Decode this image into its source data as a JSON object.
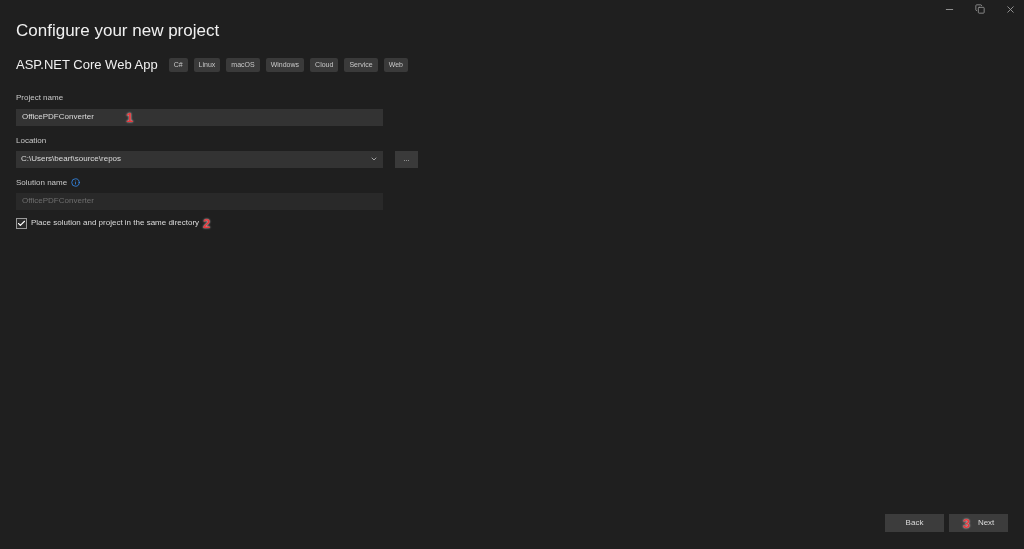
{
  "window": {
    "title": "Configure your new project"
  },
  "template": {
    "name": "ASP.NET Core Web App",
    "tags": [
      "C#",
      "Linux",
      "macOS",
      "Windows",
      "Cloud",
      "Service",
      "Web"
    ]
  },
  "project_name": {
    "label": "Project name",
    "value": "OfficePDFConverter",
    "annotation": "1"
  },
  "location": {
    "label": "Location",
    "value": "C:\\Users\\beart\\source\\repos",
    "browse": "..."
  },
  "solution_name": {
    "label": "Solution name",
    "value": "OfficePDFConverter",
    "disabled": true
  },
  "same_directory": {
    "label": "Place solution and project in the same directory",
    "checked": true,
    "annotation": "2"
  },
  "buttons": [
    {
      "label": "Back"
    },
    {
      "label": "Next",
      "annotation": "3"
    }
  ]
}
